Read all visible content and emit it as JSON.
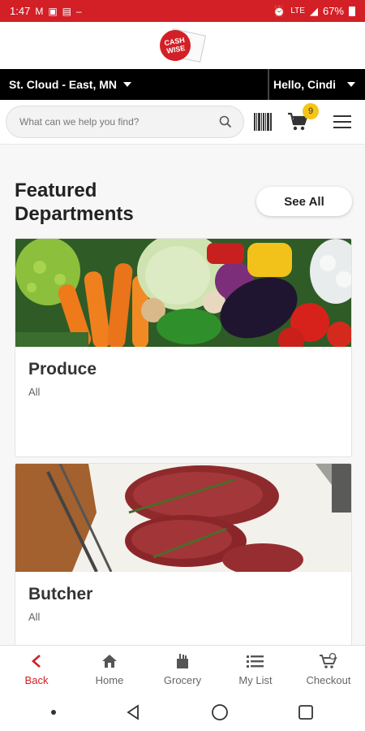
{
  "status_bar": {
    "time": "1:47",
    "battery": "67%"
  },
  "logo": {
    "line1": "CASH",
    "line2": "WISE"
  },
  "location_bar": {
    "store": "St. Cloud - East, MN",
    "greeting": "Hello, Cindi"
  },
  "search": {
    "placeholder": "What can we help you find?"
  },
  "cart": {
    "count": "9"
  },
  "featured": {
    "title": "Featured Departments",
    "see_all_label": "See All",
    "cards": [
      {
        "title": "Produce",
        "subtitle": "All"
      },
      {
        "title": "Butcher",
        "subtitle": "All"
      }
    ]
  },
  "bottom_nav": {
    "items": [
      {
        "label": "Back",
        "icon": "chevron-left-icon"
      },
      {
        "label": "Home",
        "icon": "home-icon"
      },
      {
        "label": "Grocery",
        "icon": "grocery-bag-icon"
      },
      {
        "label": "My List",
        "icon": "list-icon"
      },
      {
        "label": "Checkout",
        "icon": "cart-check-icon"
      }
    ]
  },
  "colors": {
    "brand_red": "#d31f26",
    "badge_yellow": "#f6c517",
    "bar_black": "#000000"
  }
}
